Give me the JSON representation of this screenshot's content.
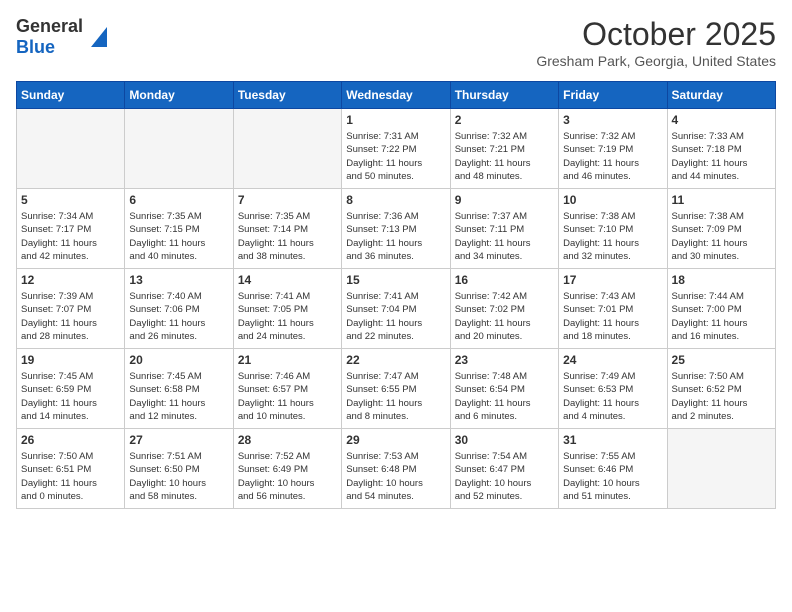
{
  "header": {
    "logo_general": "General",
    "logo_blue": "Blue",
    "month": "October 2025",
    "location": "Gresham Park, Georgia, United States"
  },
  "weekdays": [
    "Sunday",
    "Monday",
    "Tuesday",
    "Wednesday",
    "Thursday",
    "Friday",
    "Saturday"
  ],
  "weeks": [
    [
      {
        "day": "",
        "info": ""
      },
      {
        "day": "",
        "info": ""
      },
      {
        "day": "",
        "info": ""
      },
      {
        "day": "1",
        "info": "Sunrise: 7:31 AM\nSunset: 7:22 PM\nDaylight: 11 hours\nand 50 minutes."
      },
      {
        "day": "2",
        "info": "Sunrise: 7:32 AM\nSunset: 7:21 PM\nDaylight: 11 hours\nand 48 minutes."
      },
      {
        "day": "3",
        "info": "Sunrise: 7:32 AM\nSunset: 7:19 PM\nDaylight: 11 hours\nand 46 minutes."
      },
      {
        "day": "4",
        "info": "Sunrise: 7:33 AM\nSunset: 7:18 PM\nDaylight: 11 hours\nand 44 minutes."
      }
    ],
    [
      {
        "day": "5",
        "info": "Sunrise: 7:34 AM\nSunset: 7:17 PM\nDaylight: 11 hours\nand 42 minutes."
      },
      {
        "day": "6",
        "info": "Sunrise: 7:35 AM\nSunset: 7:15 PM\nDaylight: 11 hours\nand 40 minutes."
      },
      {
        "day": "7",
        "info": "Sunrise: 7:35 AM\nSunset: 7:14 PM\nDaylight: 11 hours\nand 38 minutes."
      },
      {
        "day": "8",
        "info": "Sunrise: 7:36 AM\nSunset: 7:13 PM\nDaylight: 11 hours\nand 36 minutes."
      },
      {
        "day": "9",
        "info": "Sunrise: 7:37 AM\nSunset: 7:11 PM\nDaylight: 11 hours\nand 34 minutes."
      },
      {
        "day": "10",
        "info": "Sunrise: 7:38 AM\nSunset: 7:10 PM\nDaylight: 11 hours\nand 32 minutes."
      },
      {
        "day": "11",
        "info": "Sunrise: 7:38 AM\nSunset: 7:09 PM\nDaylight: 11 hours\nand 30 minutes."
      }
    ],
    [
      {
        "day": "12",
        "info": "Sunrise: 7:39 AM\nSunset: 7:07 PM\nDaylight: 11 hours\nand 28 minutes."
      },
      {
        "day": "13",
        "info": "Sunrise: 7:40 AM\nSunset: 7:06 PM\nDaylight: 11 hours\nand 26 minutes."
      },
      {
        "day": "14",
        "info": "Sunrise: 7:41 AM\nSunset: 7:05 PM\nDaylight: 11 hours\nand 24 minutes."
      },
      {
        "day": "15",
        "info": "Sunrise: 7:41 AM\nSunset: 7:04 PM\nDaylight: 11 hours\nand 22 minutes."
      },
      {
        "day": "16",
        "info": "Sunrise: 7:42 AM\nSunset: 7:02 PM\nDaylight: 11 hours\nand 20 minutes."
      },
      {
        "day": "17",
        "info": "Sunrise: 7:43 AM\nSunset: 7:01 PM\nDaylight: 11 hours\nand 18 minutes."
      },
      {
        "day": "18",
        "info": "Sunrise: 7:44 AM\nSunset: 7:00 PM\nDaylight: 11 hours\nand 16 minutes."
      }
    ],
    [
      {
        "day": "19",
        "info": "Sunrise: 7:45 AM\nSunset: 6:59 PM\nDaylight: 11 hours\nand 14 minutes."
      },
      {
        "day": "20",
        "info": "Sunrise: 7:45 AM\nSunset: 6:58 PM\nDaylight: 11 hours\nand 12 minutes."
      },
      {
        "day": "21",
        "info": "Sunrise: 7:46 AM\nSunset: 6:57 PM\nDaylight: 11 hours\nand 10 minutes."
      },
      {
        "day": "22",
        "info": "Sunrise: 7:47 AM\nSunset: 6:55 PM\nDaylight: 11 hours\nand 8 minutes."
      },
      {
        "day": "23",
        "info": "Sunrise: 7:48 AM\nSunset: 6:54 PM\nDaylight: 11 hours\nand 6 minutes."
      },
      {
        "day": "24",
        "info": "Sunrise: 7:49 AM\nSunset: 6:53 PM\nDaylight: 11 hours\nand 4 minutes."
      },
      {
        "day": "25",
        "info": "Sunrise: 7:50 AM\nSunset: 6:52 PM\nDaylight: 11 hours\nand 2 minutes."
      }
    ],
    [
      {
        "day": "26",
        "info": "Sunrise: 7:50 AM\nSunset: 6:51 PM\nDaylight: 11 hours\nand 0 minutes."
      },
      {
        "day": "27",
        "info": "Sunrise: 7:51 AM\nSunset: 6:50 PM\nDaylight: 10 hours\nand 58 minutes."
      },
      {
        "day": "28",
        "info": "Sunrise: 7:52 AM\nSunset: 6:49 PM\nDaylight: 10 hours\nand 56 minutes."
      },
      {
        "day": "29",
        "info": "Sunrise: 7:53 AM\nSunset: 6:48 PM\nDaylight: 10 hours\nand 54 minutes."
      },
      {
        "day": "30",
        "info": "Sunrise: 7:54 AM\nSunset: 6:47 PM\nDaylight: 10 hours\nand 52 minutes."
      },
      {
        "day": "31",
        "info": "Sunrise: 7:55 AM\nSunset: 6:46 PM\nDaylight: 10 hours\nand 51 minutes."
      },
      {
        "day": "",
        "info": ""
      }
    ]
  ]
}
